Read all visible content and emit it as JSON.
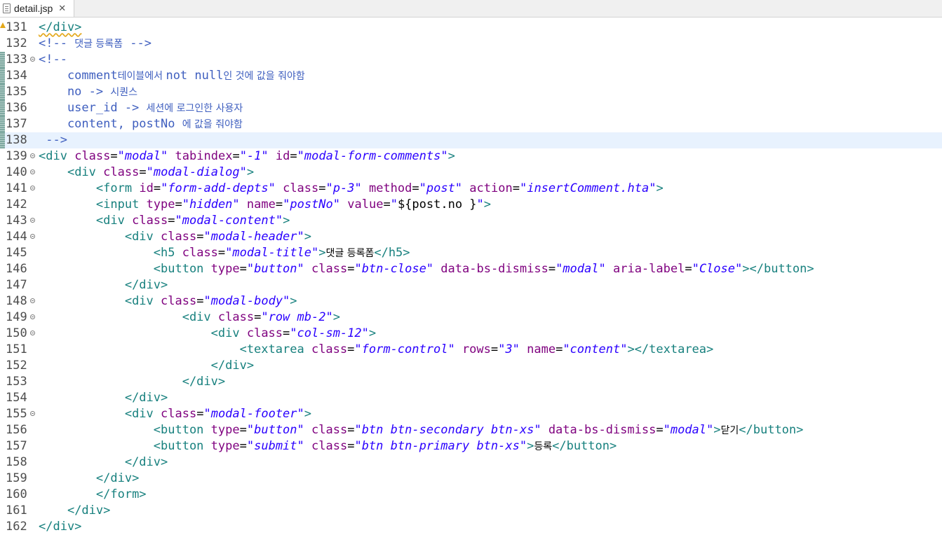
{
  "tab": {
    "label": "detail.jsp",
    "close_glyph": "✕"
  },
  "lines": [
    {
      "n": "131",
      "fold": false,
      "changed": false,
      "warn": true,
      "current": false,
      "tokens": [
        [
          "t",
          "</div>"
        ]
      ]
    },
    {
      "n": "132",
      "fold": false,
      "changed": false,
      "warn": false,
      "current": false,
      "tokens": [
        [
          "c",
          "<!-- "
        ],
        [
          "ck",
          "댓글 등록폼"
        ],
        [
          "c",
          " -->"
        ]
      ]
    },
    {
      "n": "133",
      "fold": true,
      "changed": true,
      "warn": false,
      "current": false,
      "tokens": [
        [
          "c",
          "<!--"
        ]
      ]
    },
    {
      "n": "134",
      "fold": false,
      "changed": true,
      "warn": false,
      "current": false,
      "tokens": [
        [
          "c",
          "    comment"
        ],
        [
          "ck",
          "테이블에서 "
        ],
        [
          "c",
          "not null"
        ],
        [
          "ck",
          "인 것에 값을 줘야함"
        ]
      ]
    },
    {
      "n": "135",
      "fold": false,
      "changed": true,
      "warn": false,
      "current": false,
      "tokens": [
        [
          "c",
          "    no -> "
        ],
        [
          "ck",
          "시퀀스"
        ]
      ]
    },
    {
      "n": "136",
      "fold": false,
      "changed": true,
      "warn": false,
      "current": false,
      "tokens": [
        [
          "c",
          "    user_id -> "
        ],
        [
          "ck",
          "세션에 로그인한 사용자"
        ]
      ]
    },
    {
      "n": "137",
      "fold": false,
      "changed": true,
      "warn": false,
      "current": false,
      "tokens": [
        [
          "c",
          "    content, postNo "
        ],
        [
          "ck",
          "에 값을 줘야함"
        ]
      ]
    },
    {
      "n": "138",
      "fold": false,
      "changed": true,
      "warn": false,
      "current": true,
      "tokens": [
        [
          "c",
          " -->"
        ]
      ]
    },
    {
      "n": "139",
      "fold": true,
      "changed": false,
      "warn": false,
      "current": false,
      "tokens": [
        [
          "t",
          "<div"
        ],
        [
          "p",
          " "
        ],
        [
          "a",
          "class"
        ],
        [
          "p",
          "="
        ],
        [
          "v",
          "\"modal\""
        ],
        [
          "p",
          " "
        ],
        [
          "a",
          "tabindex"
        ],
        [
          "p",
          "="
        ],
        [
          "v",
          "\"-1\""
        ],
        [
          "p",
          " "
        ],
        [
          "a",
          "id"
        ],
        [
          "p",
          "="
        ],
        [
          "v",
          "\"modal-form-comments\""
        ],
        [
          "t",
          ">"
        ]
      ]
    },
    {
      "n": "140",
      "fold": true,
      "changed": false,
      "warn": false,
      "current": false,
      "tokens": [
        [
          "p",
          "    "
        ],
        [
          "t",
          "<div"
        ],
        [
          "p",
          " "
        ],
        [
          "a",
          "class"
        ],
        [
          "p",
          "="
        ],
        [
          "v",
          "\"modal-dialog\""
        ],
        [
          "t",
          ">"
        ]
      ]
    },
    {
      "n": "141",
      "fold": true,
      "changed": false,
      "warn": false,
      "current": false,
      "tokens": [
        [
          "p",
          "        "
        ],
        [
          "t",
          "<form"
        ],
        [
          "p",
          " "
        ],
        [
          "a",
          "id"
        ],
        [
          "p",
          "="
        ],
        [
          "v",
          "\"form-add-depts\""
        ],
        [
          "p",
          " "
        ],
        [
          "a",
          "class"
        ],
        [
          "p",
          "="
        ],
        [
          "v",
          "\"p-3\""
        ],
        [
          "p",
          " "
        ],
        [
          "a",
          "method"
        ],
        [
          "p",
          "="
        ],
        [
          "v",
          "\"post\""
        ],
        [
          "p",
          " "
        ],
        [
          "a",
          "action"
        ],
        [
          "p",
          "="
        ],
        [
          "v",
          "\"insertComment.hta\""
        ],
        [
          "t",
          ">"
        ]
      ]
    },
    {
      "n": "142",
      "fold": false,
      "changed": false,
      "warn": false,
      "current": false,
      "tokens": [
        [
          "p",
          "        "
        ],
        [
          "t",
          "<input"
        ],
        [
          "p",
          " "
        ],
        [
          "a",
          "type"
        ],
        [
          "p",
          "="
        ],
        [
          "v",
          "\"hidden\""
        ],
        [
          "p",
          " "
        ],
        [
          "a",
          "name"
        ],
        [
          "p",
          "="
        ],
        [
          "v",
          "\"postNo\""
        ],
        [
          "p",
          " "
        ],
        [
          "a",
          "value"
        ],
        [
          "p",
          "="
        ],
        [
          "v",
          "\""
        ],
        [
          "p",
          "${post.no }"
        ],
        [
          "v",
          "\""
        ],
        [
          "t",
          ">"
        ]
      ]
    },
    {
      "n": "143",
      "fold": true,
      "changed": false,
      "warn": false,
      "current": false,
      "tokens": [
        [
          "p",
          "        "
        ],
        [
          "t",
          "<div"
        ],
        [
          "p",
          " "
        ],
        [
          "a",
          "class"
        ],
        [
          "p",
          "="
        ],
        [
          "v",
          "\"modal-content\""
        ],
        [
          "t",
          ">"
        ]
      ]
    },
    {
      "n": "144",
      "fold": true,
      "changed": false,
      "warn": false,
      "current": false,
      "tokens": [
        [
          "p",
          "            "
        ],
        [
          "t",
          "<div"
        ],
        [
          "p",
          " "
        ],
        [
          "a",
          "class"
        ],
        [
          "p",
          "="
        ],
        [
          "v",
          "\"modal-header\""
        ],
        [
          "t",
          ">"
        ]
      ]
    },
    {
      "n": "145",
      "fold": false,
      "changed": false,
      "warn": false,
      "current": false,
      "tokens": [
        [
          "p",
          "                "
        ],
        [
          "t",
          "<h5"
        ],
        [
          "p",
          " "
        ],
        [
          "a",
          "class"
        ],
        [
          "p",
          "="
        ],
        [
          "v",
          "\"modal-title\""
        ],
        [
          "t",
          ">"
        ],
        [
          "k",
          "댓글 등록폼"
        ],
        [
          "t",
          "</h5>"
        ]
      ]
    },
    {
      "n": "146",
      "fold": false,
      "changed": false,
      "warn": false,
      "current": false,
      "tokens": [
        [
          "p",
          "                "
        ],
        [
          "t",
          "<button"
        ],
        [
          "p",
          " "
        ],
        [
          "a",
          "type"
        ],
        [
          "p",
          "="
        ],
        [
          "v",
          "\"button\""
        ],
        [
          "p",
          " "
        ],
        [
          "a",
          "class"
        ],
        [
          "p",
          "="
        ],
        [
          "v",
          "\"btn-close\""
        ],
        [
          "p",
          " "
        ],
        [
          "a",
          "data-bs-dismiss"
        ],
        [
          "p",
          "="
        ],
        [
          "v",
          "\"modal\""
        ],
        [
          "p",
          " "
        ],
        [
          "a",
          "aria-label"
        ],
        [
          "p",
          "="
        ],
        [
          "v",
          "\"Close\""
        ],
        [
          "t",
          "></button>"
        ]
      ]
    },
    {
      "n": "147",
      "fold": false,
      "changed": false,
      "warn": false,
      "current": false,
      "tokens": [
        [
          "p",
          "            "
        ],
        [
          "t",
          "</div>"
        ]
      ]
    },
    {
      "n": "148",
      "fold": true,
      "changed": false,
      "warn": false,
      "current": false,
      "tokens": [
        [
          "p",
          "            "
        ],
        [
          "t",
          "<div"
        ],
        [
          "p",
          " "
        ],
        [
          "a",
          "class"
        ],
        [
          "p",
          "="
        ],
        [
          "v",
          "\"modal-body\""
        ],
        [
          "t",
          ">"
        ]
      ]
    },
    {
      "n": "149",
      "fold": true,
      "changed": false,
      "warn": false,
      "current": false,
      "tokens": [
        [
          "p",
          "                    "
        ],
        [
          "t",
          "<div"
        ],
        [
          "p",
          " "
        ],
        [
          "a",
          "class"
        ],
        [
          "p",
          "="
        ],
        [
          "v",
          "\"row mb-2\""
        ],
        [
          "t",
          ">"
        ]
      ]
    },
    {
      "n": "150",
      "fold": true,
      "changed": false,
      "warn": false,
      "current": false,
      "tokens": [
        [
          "p",
          "                        "
        ],
        [
          "t",
          "<div"
        ],
        [
          "p",
          " "
        ],
        [
          "a",
          "class"
        ],
        [
          "p",
          "="
        ],
        [
          "v",
          "\"col-sm-12\""
        ],
        [
          "t",
          ">"
        ]
      ]
    },
    {
      "n": "151",
      "fold": false,
      "changed": false,
      "warn": false,
      "current": false,
      "tokens": [
        [
          "p",
          "                            "
        ],
        [
          "t",
          "<textarea"
        ],
        [
          "p",
          " "
        ],
        [
          "a",
          "class"
        ],
        [
          "p",
          "="
        ],
        [
          "v",
          "\"form-control\""
        ],
        [
          "p",
          " "
        ],
        [
          "a",
          "rows"
        ],
        [
          "p",
          "="
        ],
        [
          "v",
          "\"3\""
        ],
        [
          "p",
          " "
        ],
        [
          "a",
          "name"
        ],
        [
          "p",
          "="
        ],
        [
          "v",
          "\"content\""
        ],
        [
          "t",
          "></textarea>"
        ]
      ]
    },
    {
      "n": "152",
      "fold": false,
      "changed": false,
      "warn": false,
      "current": false,
      "tokens": [
        [
          "p",
          "                        "
        ],
        [
          "t",
          "</div>"
        ]
      ]
    },
    {
      "n": "153",
      "fold": false,
      "changed": false,
      "warn": false,
      "current": false,
      "tokens": [
        [
          "p",
          "                    "
        ],
        [
          "t",
          "</div>"
        ]
      ]
    },
    {
      "n": "154",
      "fold": false,
      "changed": false,
      "warn": false,
      "current": false,
      "tokens": [
        [
          "p",
          "            "
        ],
        [
          "t",
          "</div>"
        ]
      ]
    },
    {
      "n": "155",
      "fold": true,
      "changed": false,
      "warn": false,
      "current": false,
      "tokens": [
        [
          "p",
          "            "
        ],
        [
          "t",
          "<div"
        ],
        [
          "p",
          " "
        ],
        [
          "a",
          "class"
        ],
        [
          "p",
          "="
        ],
        [
          "v",
          "\"modal-footer\""
        ],
        [
          "t",
          ">"
        ]
      ]
    },
    {
      "n": "156",
      "fold": false,
      "changed": false,
      "warn": false,
      "current": false,
      "tokens": [
        [
          "p",
          "                "
        ],
        [
          "t",
          "<button"
        ],
        [
          "p",
          " "
        ],
        [
          "a",
          "type"
        ],
        [
          "p",
          "="
        ],
        [
          "v",
          "\"button\""
        ],
        [
          "p",
          " "
        ],
        [
          "a",
          "class"
        ],
        [
          "p",
          "="
        ],
        [
          "v",
          "\"btn btn-secondary btn-xs\""
        ],
        [
          "p",
          " "
        ],
        [
          "a",
          "data-bs-dismiss"
        ],
        [
          "p",
          "="
        ],
        [
          "v",
          "\"modal\""
        ],
        [
          "t",
          ">"
        ],
        [
          "k",
          "닫기"
        ],
        [
          "t",
          "</button>"
        ]
      ]
    },
    {
      "n": "157",
      "fold": false,
      "changed": false,
      "warn": false,
      "current": false,
      "tokens": [
        [
          "p",
          "                "
        ],
        [
          "t",
          "<button"
        ],
        [
          "p",
          " "
        ],
        [
          "a",
          "type"
        ],
        [
          "p",
          "="
        ],
        [
          "v",
          "\"submit\""
        ],
        [
          "p",
          " "
        ],
        [
          "a",
          "class"
        ],
        [
          "p",
          "="
        ],
        [
          "v",
          "\"btn btn-primary btn-xs\""
        ],
        [
          "t",
          ">"
        ],
        [
          "k",
          "등록"
        ],
        [
          "t",
          "</button>"
        ]
      ]
    },
    {
      "n": "158",
      "fold": false,
      "changed": false,
      "warn": false,
      "current": false,
      "tokens": [
        [
          "p",
          "            "
        ],
        [
          "t",
          "</div>"
        ]
      ]
    },
    {
      "n": "159",
      "fold": false,
      "changed": false,
      "warn": false,
      "current": false,
      "tokens": [
        [
          "p",
          "        "
        ],
        [
          "t",
          "</div>"
        ]
      ]
    },
    {
      "n": "160",
      "fold": false,
      "changed": false,
      "warn": false,
      "current": false,
      "tokens": [
        [
          "p",
          "        "
        ],
        [
          "t",
          "</form>"
        ]
      ]
    },
    {
      "n": "161",
      "fold": false,
      "changed": false,
      "warn": false,
      "current": false,
      "tokens": [
        [
          "p",
          "    "
        ],
        [
          "t",
          "</div>"
        ]
      ]
    },
    {
      "n": "162",
      "fold": false,
      "changed": false,
      "warn": false,
      "current": false,
      "tokens": [
        [
          "t",
          "</div>"
        ]
      ]
    }
  ]
}
